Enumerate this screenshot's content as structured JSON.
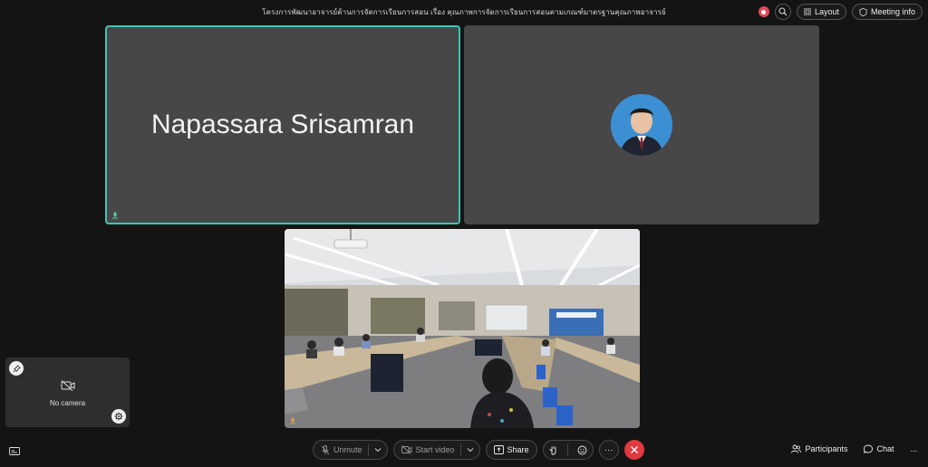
{
  "window": {
    "title": "โครงการพัฒนาอาจารย์ด้านการจัดการเรียนการสอน เรื่อง คุณภาพการจัดการเรียนการสอนตามเกณฑ์มาตรฐานคุณภาพอาจารย์"
  },
  "header": {
    "layout_label": "Layout",
    "meeting_info_label": "Meeting info"
  },
  "participants": [
    {
      "name": "Napassara Srisamran",
      "active_speaker": true
    }
  ],
  "self_view": {
    "status": "No camera"
  },
  "toolbar": {
    "unmute_label": "Unmute",
    "start_video_label": "Start video",
    "share_label": "Share",
    "more_label": "···"
  },
  "side_panel": {
    "participants_label": "Participants",
    "chat_label": "Chat",
    "more_label": "..."
  },
  "colors": {
    "active_border": "#3fc4b4",
    "end_call": "#e0393e",
    "recording": "#e04b55"
  }
}
